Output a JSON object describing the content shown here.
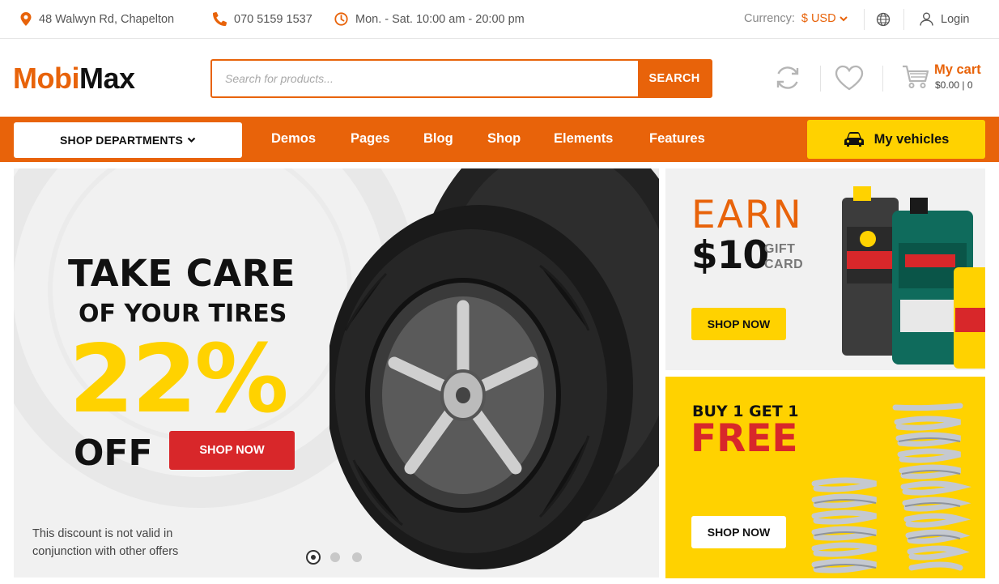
{
  "topbar": {
    "address": "48 Walwyn Rd, Chapelton",
    "phone": "070 5159 1537",
    "hours": "Mon. - Sat. 10:00 am - 20:00 pm",
    "currency_label": "Currency:",
    "currency_value": "$ USD",
    "login_label": "Login"
  },
  "header": {
    "logo_part1": "Mobi",
    "logo_part2": "Max",
    "search_placeholder": "Search for products...",
    "search_button": "SEARCH",
    "cart_title": "My cart",
    "cart_summary": "$0.00 | 0"
  },
  "nav": {
    "departments_label": "SHOP DEPARTMENTS",
    "items": [
      "Demos",
      "Pages",
      "Blog",
      "Shop",
      "Elements",
      "Features"
    ],
    "vehicles_label": "My vehicles"
  },
  "hero": {
    "line1": "TAKE CARE",
    "line2": "OF YOUR TIRES",
    "percent": "22%",
    "off": "OFF",
    "button": "SHOP NOW",
    "note": "This discount is not valid in conjunction with other offers",
    "slide_count": 3,
    "active_slide": 1
  },
  "promo1": {
    "line1": "EARN",
    "amount": "$10",
    "gift_line1": "GIFT",
    "gift_line2": "CARD",
    "button": "SHOP NOW"
  },
  "promo2": {
    "line1": "BUY 1 GET 1",
    "line2": "FREE",
    "button": "SHOP NOW"
  },
  "colors": {
    "brand_orange": "#e8630a",
    "accent_yellow": "#ffd200",
    "sale_red": "#d8272a"
  },
  "icons": [
    "map-pin-icon",
    "phone-icon",
    "clock-icon",
    "chevron-down-icon",
    "globe-icon",
    "user-icon",
    "refresh-icon",
    "heart-icon",
    "cart-icon",
    "car-icon"
  ]
}
